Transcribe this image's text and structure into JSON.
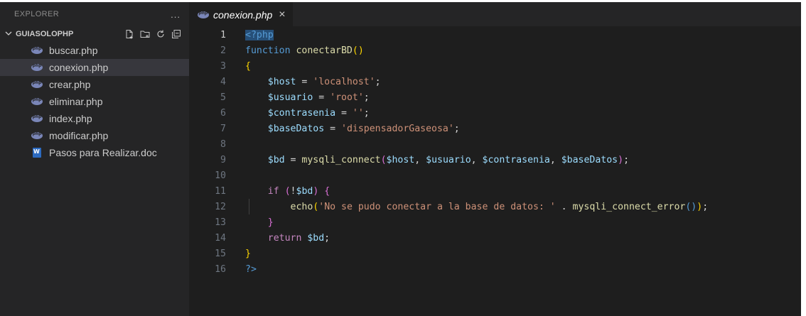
{
  "sidebar": {
    "title": "EXPLORER",
    "more_icon": "...",
    "folder": "GUIASOLOPHP",
    "actions": [
      "new-file-icon",
      "new-folder-icon",
      "refresh-icon",
      "collapse-icon"
    ],
    "files": [
      {
        "name": "buscar.php",
        "icon": "php-icon",
        "selected": false
      },
      {
        "name": "conexion.php",
        "icon": "php-icon",
        "selected": true
      },
      {
        "name": "crear.php",
        "icon": "php-icon",
        "selected": false
      },
      {
        "name": "eliminar.php",
        "icon": "php-icon",
        "selected": false
      },
      {
        "name": "index.php",
        "icon": "php-icon",
        "selected": false
      },
      {
        "name": "modificar.php",
        "icon": "php-icon",
        "selected": false
      },
      {
        "name": "Pasos para Realizar.doc",
        "icon": "word-doc-icon",
        "selected": false
      }
    ]
  },
  "editor": {
    "tab": {
      "label": "conexion.php",
      "close": "×"
    },
    "lines": [
      {
        "n": "1",
        "tokens": [
          [
            "tag",
            "<?php"
          ]
        ]
      },
      {
        "n": "2",
        "tokens": [
          [
            "kw",
            "function "
          ],
          [
            "fn",
            "conectarBD"
          ],
          [
            "brk",
            "()"
          ]
        ]
      },
      {
        "n": "3",
        "tokens": [
          [
            "brk",
            "{"
          ]
        ]
      },
      {
        "n": "4",
        "tokens": [
          [
            "txt",
            "    "
          ],
          [
            "var",
            "$host"
          ],
          [
            "txt",
            " = "
          ],
          [
            "str",
            "'localhost'"
          ],
          [
            "txt",
            ";"
          ]
        ]
      },
      {
        "n": "5",
        "tokens": [
          [
            "txt",
            "    "
          ],
          [
            "var",
            "$usuario"
          ],
          [
            "txt",
            " = "
          ],
          [
            "str",
            "'root'"
          ],
          [
            "txt",
            ";"
          ]
        ]
      },
      {
        "n": "6",
        "tokens": [
          [
            "txt",
            "    "
          ],
          [
            "var",
            "$contrasenia"
          ],
          [
            "txt",
            " = "
          ],
          [
            "str",
            "''"
          ],
          [
            "txt",
            ";"
          ]
        ]
      },
      {
        "n": "7",
        "tokens": [
          [
            "txt",
            "    "
          ],
          [
            "var",
            "$baseDatos"
          ],
          [
            "txt",
            " = "
          ],
          [
            "str",
            "'dispensadorGaseosa'"
          ],
          [
            "txt",
            ";"
          ]
        ]
      },
      {
        "n": "8",
        "tokens": []
      },
      {
        "n": "9",
        "tokens": [
          [
            "txt",
            "    "
          ],
          [
            "var",
            "$bd"
          ],
          [
            "txt",
            " = "
          ],
          [
            "fn",
            "mysqli_connect"
          ],
          [
            "brk2",
            "("
          ],
          [
            "var",
            "$host"
          ],
          [
            "txt",
            ", "
          ],
          [
            "var",
            "$usuario"
          ],
          [
            "txt",
            ", "
          ],
          [
            "var",
            "$contrasenia"
          ],
          [
            "txt",
            ", "
          ],
          [
            "var",
            "$baseDatos"
          ],
          [
            "brk2",
            ")"
          ],
          [
            "txt",
            ";"
          ]
        ]
      },
      {
        "n": "10",
        "tokens": []
      },
      {
        "n": "11",
        "tokens": [
          [
            "txt",
            "    "
          ],
          [
            "kw2",
            "if "
          ],
          [
            "brk2",
            "("
          ],
          [
            "txt",
            "!"
          ],
          [
            "var",
            "$bd"
          ],
          [
            "brk2",
            ")"
          ],
          [
            "txt",
            " "
          ],
          [
            "brk2",
            "{"
          ]
        ]
      },
      {
        "n": "12",
        "tokens": [
          [
            "txt",
            "        "
          ],
          [
            "fn",
            "echo"
          ],
          [
            "brk",
            "("
          ],
          [
            "str",
            "'No se pudo conectar a la base de datos: '"
          ],
          [
            "txt",
            " . "
          ],
          [
            "fn",
            "mysqli_connect_error"
          ],
          [
            "kw",
            "()"
          ],
          [
            "brk",
            ")"
          ],
          [
            "txt",
            ";"
          ]
        ]
      },
      {
        "n": "13",
        "tokens": [
          [
            "txt",
            "    "
          ],
          [
            "brk2",
            "}"
          ]
        ]
      },
      {
        "n": "14",
        "tokens": [
          [
            "txt",
            "    "
          ],
          [
            "kw2",
            "return "
          ],
          [
            "var",
            "$bd"
          ],
          [
            "txt",
            ";"
          ]
        ]
      },
      {
        "n": "15",
        "tokens": [
          [
            "brk",
            "}"
          ]
        ]
      },
      {
        "n": "16",
        "tokens": [
          [
            "tag",
            "?>"
          ]
        ]
      }
    ]
  }
}
